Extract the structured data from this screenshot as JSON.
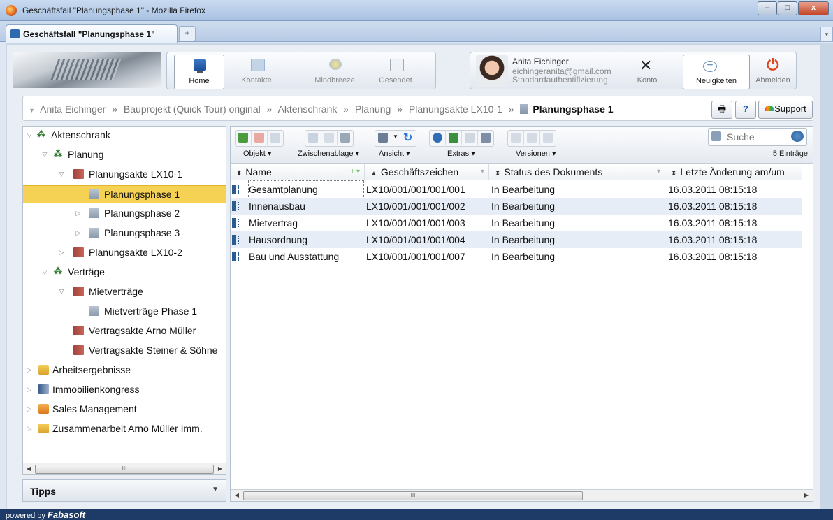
{
  "window": {
    "title": "Geschäftsfall \"Planungsphase 1\" - Mozilla Firefox",
    "min": "–",
    "max": "□",
    "close": "x"
  },
  "browser_tab": {
    "label": "Geschäftsfall \"Planungsphase 1\"",
    "new_tab": "+"
  },
  "nav": {
    "home": "Home",
    "kontakte": "Kontakte",
    "mindbreeze": "Mindbreeze",
    "gesendet": "Gesendet"
  },
  "user": {
    "name": "Anita Eichinger",
    "email": "eichingeranita@gmail.com",
    "auth": "Standardauthentifizierung",
    "konto": "Konto",
    "neuigkeiten": "Neuigkeiten",
    "abmelden": "Abmelden"
  },
  "breadcrumb": {
    "items": [
      "Anita Eichinger",
      "Bauprojekt (Quick Tour) original",
      "Aktenschrank",
      "Planung",
      "Planungsakte LX10-1"
    ],
    "separator": "»",
    "current": "Planungsphase 1",
    "print": "🖶",
    "help": "?",
    "support": "Support"
  },
  "tree": [
    {
      "label": "Aktenschrank",
      "twisty": "▽",
      "icon": "tree-icon"
    },
    {
      "label": "Planung",
      "twisty": "▽",
      "icon": "tree-icon"
    },
    {
      "label": "Planungsakte LX10-1",
      "twisty": "▽",
      "icon": "folder-red-icon"
    },
    {
      "label": "Planungsphase 1",
      "twisty": "",
      "icon": "document-icon"
    },
    {
      "label": "Planungsphase 2",
      "twisty": "▷",
      "icon": "document-icon"
    },
    {
      "label": "Planungsphase 3",
      "twisty": "▷",
      "icon": "document-icon"
    },
    {
      "label": "Planungsakte LX10-2",
      "twisty": "▷",
      "icon": "folder-red-icon"
    },
    {
      "label": "Verträge",
      "twisty": "▽",
      "icon": "tree-icon"
    },
    {
      "label": "Mietverträge",
      "twisty": "▽",
      "icon": "folder-red-icon"
    },
    {
      "label": "Mietverträge Phase 1",
      "twisty": "",
      "icon": "document-icon"
    },
    {
      "label": "Vertragsakte Arno Müller",
      "twisty": "",
      "icon": "folder-red-icon"
    },
    {
      "label": "Vertragsakte Steiner & Söhne",
      "twisty": "",
      "icon": "folder-red-icon"
    },
    {
      "label": "Arbeitsergebnisse",
      "twisty": "▷",
      "icon": "folder-yellow-icon"
    },
    {
      "label": "Immobilienkongress",
      "twisty": "▷",
      "icon": "picture-icon"
    },
    {
      "label": "Sales Management",
      "twisty": "▷",
      "icon": "folder-orange-icon"
    },
    {
      "label": "Zusammenarbeit Arno Müller Imm.",
      "twisty": "▷",
      "icon": "folder-yellow-icon"
    }
  ],
  "tipps": {
    "label": "Tipps"
  },
  "toolbar": {
    "groups": [
      "Objekt ▾",
      "Zwischenablage ▾",
      "Ansicht ▾",
      "Extras ▾",
      "Versionen ▾"
    ],
    "search_placeholder": "Suche",
    "count": "5 Einträge"
  },
  "table": {
    "columns": [
      "Name",
      "Geschäftszeichen",
      "Status des Dokuments",
      "Letzte Änderung am/um"
    ],
    "rows": [
      {
        "name": "Gesamtplanung",
        "code": "LX10/001/001/001/001",
        "status": "In Bearbeitung",
        "date": "16.03.2011 08:15:18"
      },
      {
        "name": "Innenausbau",
        "code": "LX10/001/001/001/002",
        "status": "In Bearbeitung",
        "date": "16.03.2011 08:15:18"
      },
      {
        "name": "Mietvertrag",
        "code": "LX10/001/001/001/003",
        "status": "In Bearbeitung",
        "date": "16.03.2011 08:15:18"
      },
      {
        "name": "Hausordnung",
        "code": "LX10/001/001/001/004",
        "status": "In Bearbeitung",
        "date": "16.03.2011 08:15:18"
      },
      {
        "name": "Bau und Ausstattung",
        "code": "LX10/001/001/001/007",
        "status": "In Bearbeitung",
        "date": "16.03.2011 08:15:18"
      }
    ]
  },
  "scroll": {
    "thumb": "III"
  },
  "footer": {
    "powered": "powered by",
    "brand": "Fabasoft"
  }
}
